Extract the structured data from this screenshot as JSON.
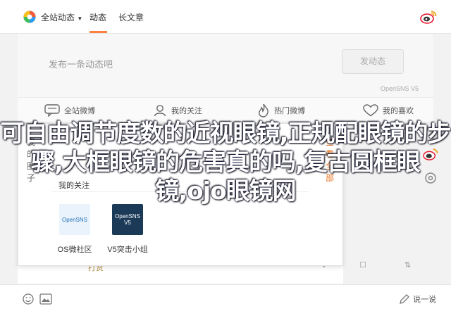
{
  "header": {
    "dropdown_label": "全站动态",
    "tab_active": "动态",
    "tab_long_article": "长文章",
    "accent_color": "#ff8140"
  },
  "composer": {
    "placeholder": "发布一条动态吧",
    "send_label": "发动态",
    "version_label": "OpenSNS V5"
  },
  "toolbar": {
    "items": [
      {
        "label": "全站微博",
        "icon": "chat-bubble-icon"
      },
      {
        "label": "我的关注",
        "icon": "user-icon"
      },
      {
        "label": "热门微博",
        "icon": "flame-icon"
      },
      {
        "label": "我的喜欢",
        "icon": "heart-icon"
      }
    ]
  },
  "panel": {
    "left_side": "我的圈子",
    "right_side": "查看全部",
    "heading": "我的关注",
    "apps": [
      {
        "name": "OS微社区",
        "thumb_label": "OpenSNS"
      },
      {
        "name": "V5突击小组",
        "thumb_label": "OpenSNS V5"
      }
    ]
  },
  "stub": {
    "text": "打赏"
  },
  "footer": {
    "right_text": "说一说"
  },
  "overlay": {
    "title": "可自由调节度数的近视眼镜,正规配眼镜的步骤,大框眼镜的危害真的吗,复古圆框眼镜,ojo眼镜网"
  }
}
